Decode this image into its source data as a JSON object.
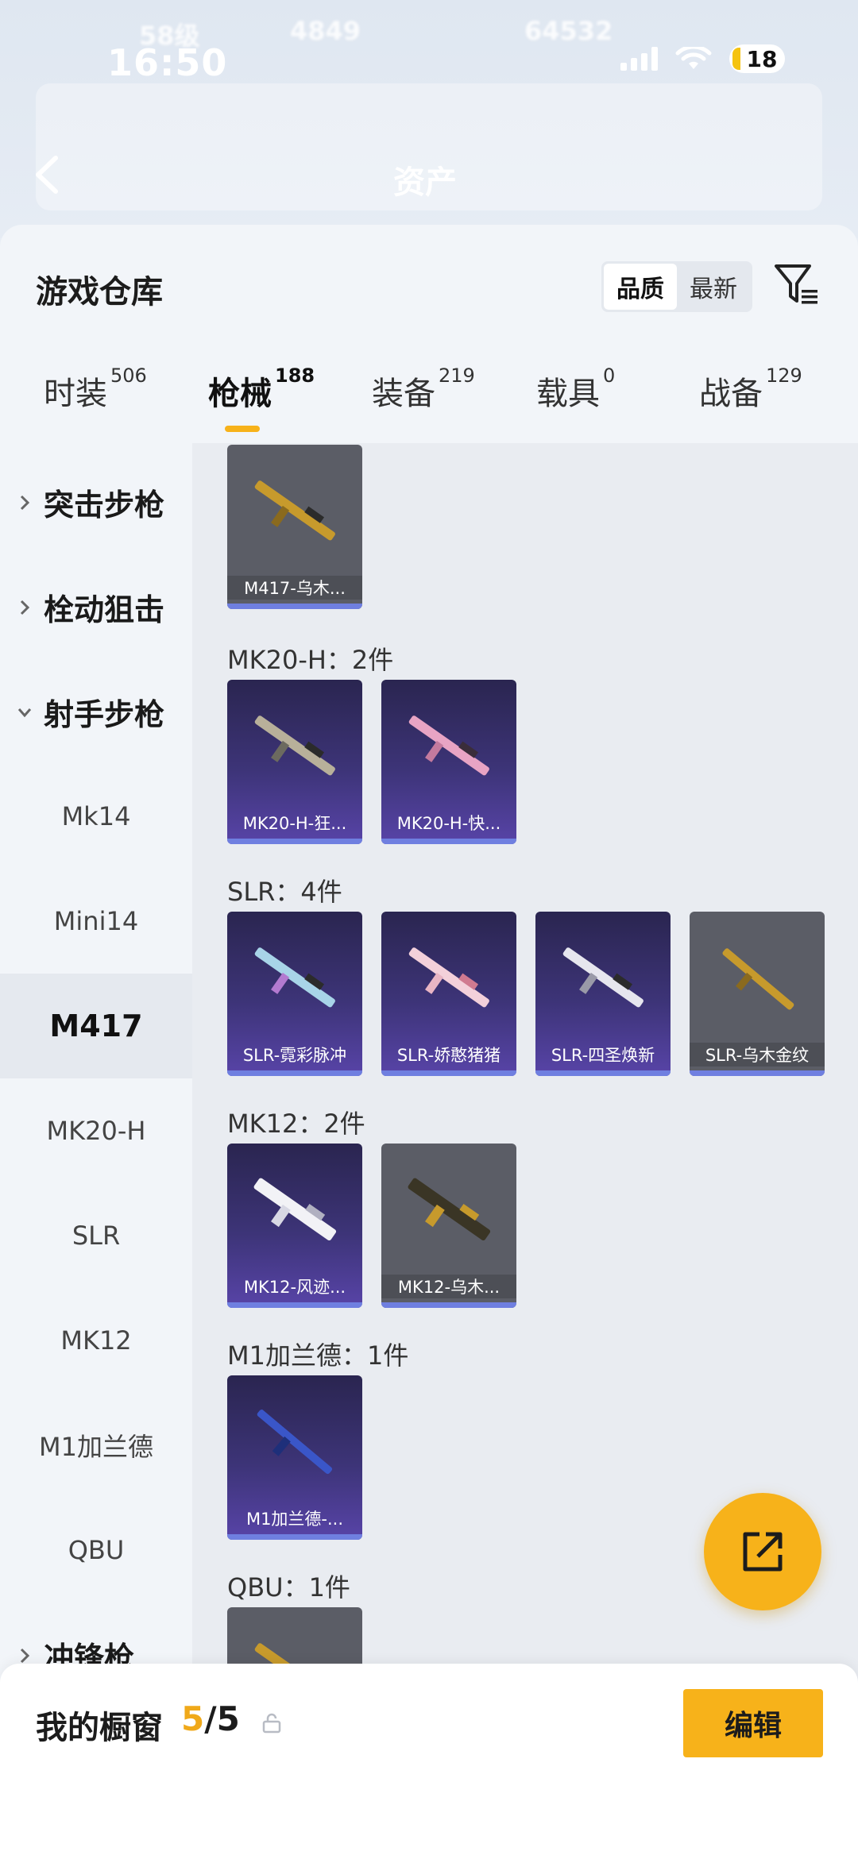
{
  "status_bar": {
    "time": "16:50",
    "battery": "18"
  },
  "background_header": {
    "level": "58级",
    "stat_a": "4849",
    "stat_b": "64532",
    "title": "资产"
  },
  "sheet": {
    "title": "游戏仓库",
    "sort_options": [
      {
        "label": "品质",
        "active": true
      },
      {
        "label": "最新",
        "active": false
      }
    ]
  },
  "tabs": [
    {
      "label": "时装",
      "count": "506"
    },
    {
      "label": "枪械",
      "count": "188",
      "active": true
    },
    {
      "label": "装备",
      "count": "219"
    },
    {
      "label": "载具",
      "count": "0"
    },
    {
      "label": "战备",
      "count": "129"
    }
  ],
  "sidebar": [
    {
      "label": "突击步枪",
      "type": "group",
      "expanded": false
    },
    {
      "label": "栓动狙击",
      "type": "group",
      "expanded": false
    },
    {
      "label": "射手步枪",
      "type": "group",
      "expanded": true
    },
    {
      "label": "Mk14",
      "type": "item"
    },
    {
      "label": "Mini14",
      "type": "item"
    },
    {
      "label": "M417",
      "type": "item",
      "selected": true
    },
    {
      "label": "MK20-H",
      "type": "item"
    },
    {
      "label": "SLR",
      "type": "item"
    },
    {
      "label": "MK12",
      "type": "item"
    },
    {
      "label": "M1加兰德",
      "type": "item"
    },
    {
      "label": "QBU",
      "type": "item"
    },
    {
      "label": "冲锋枪",
      "type": "group",
      "expanded": false
    }
  ],
  "content": {
    "groups": [
      {
        "label": "",
        "items": [
          {
            "name": "M417-乌木...",
            "rarity": "grey"
          }
        ]
      },
      {
        "label": "MK20-H：2件",
        "items": [
          {
            "name": "MK20-H-狂...",
            "rarity": "purple"
          },
          {
            "name": "MK20-H-快...",
            "rarity": "purple"
          }
        ]
      },
      {
        "label": "SLR：4件",
        "items": [
          {
            "name": "SLR-霓彩脉冲",
            "rarity": "purple"
          },
          {
            "name": "SLR-娇憨猪猪",
            "rarity": "purple"
          },
          {
            "name": "SLR-四圣焕新",
            "rarity": "purple"
          },
          {
            "name": "SLR-乌木金纹",
            "rarity": "grey"
          }
        ]
      },
      {
        "label": "MK12：2件",
        "items": [
          {
            "name": "MK12-风迹...",
            "rarity": "purple"
          },
          {
            "name": "MK12-乌木...",
            "rarity": "grey"
          }
        ]
      },
      {
        "label": "M1加兰德：1件",
        "items": [
          {
            "name": "M1加兰德-...",
            "rarity": "purple"
          }
        ]
      },
      {
        "label": "QBU：1件",
        "items": [
          {
            "name": "",
            "rarity": "grey"
          }
        ]
      }
    ]
  },
  "bottom_bar": {
    "label": "我的橱窗",
    "current": "5",
    "total": "/5",
    "edit_label": "编辑"
  },
  "colors": {
    "accent": "#f7b21a",
    "purple_card": "#3d3478",
    "grey_card": "#5b5d66",
    "rarity_bar": "#6f7fe0"
  }
}
